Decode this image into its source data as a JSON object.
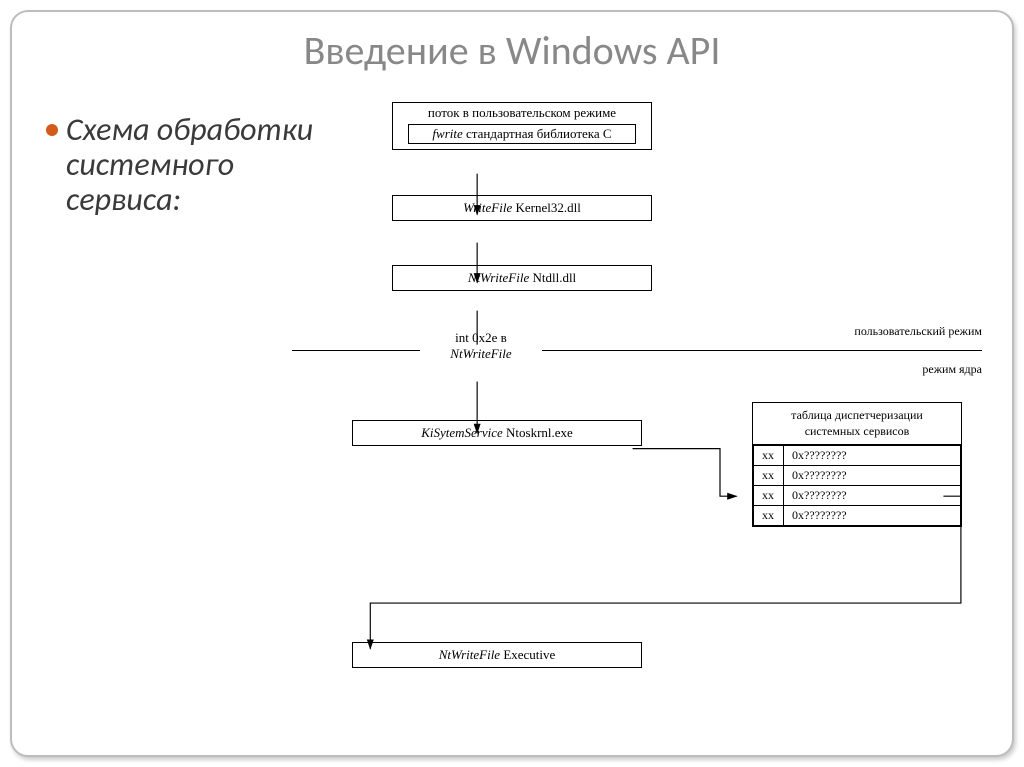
{
  "title": "Введение в Windows API",
  "bullet": "Схема обработки системного сервиса:",
  "boxes": {
    "user_thread": "поток в пользовательском режиме",
    "fwrite_em": "fwrite",
    "fwrite_rest": " стандартная библиотека C",
    "writefile_em": "WriteFile",
    "writefile_rest": " Kernel32.dll",
    "ntwrite_em": "NtWriteFile",
    "ntwrite_rest": " Ntdll.dll",
    "interrupt_line1": "int 0x2e в",
    "interrupt_line2_em": "NtWriteFile",
    "kisys_em": "KiSytemService",
    "kisys_rest": " Ntoskrnl.exe",
    "exec_em": "NtWriteFile",
    "exec_rest": " Executive"
  },
  "labels": {
    "user_mode": "пользовательский режим",
    "kernel_mode": "режим ядра"
  },
  "table": {
    "header_line1": "таблица диспетчеризации",
    "header_line2": "системных сервисов",
    "rows": [
      {
        "idx": "xx",
        "val": "0x????????"
      },
      {
        "idx": "xx",
        "val": "0x????????"
      },
      {
        "idx": "xx",
        "val": "0x????????"
      },
      {
        "idx": "xx",
        "val": "0x????????"
      }
    ]
  }
}
